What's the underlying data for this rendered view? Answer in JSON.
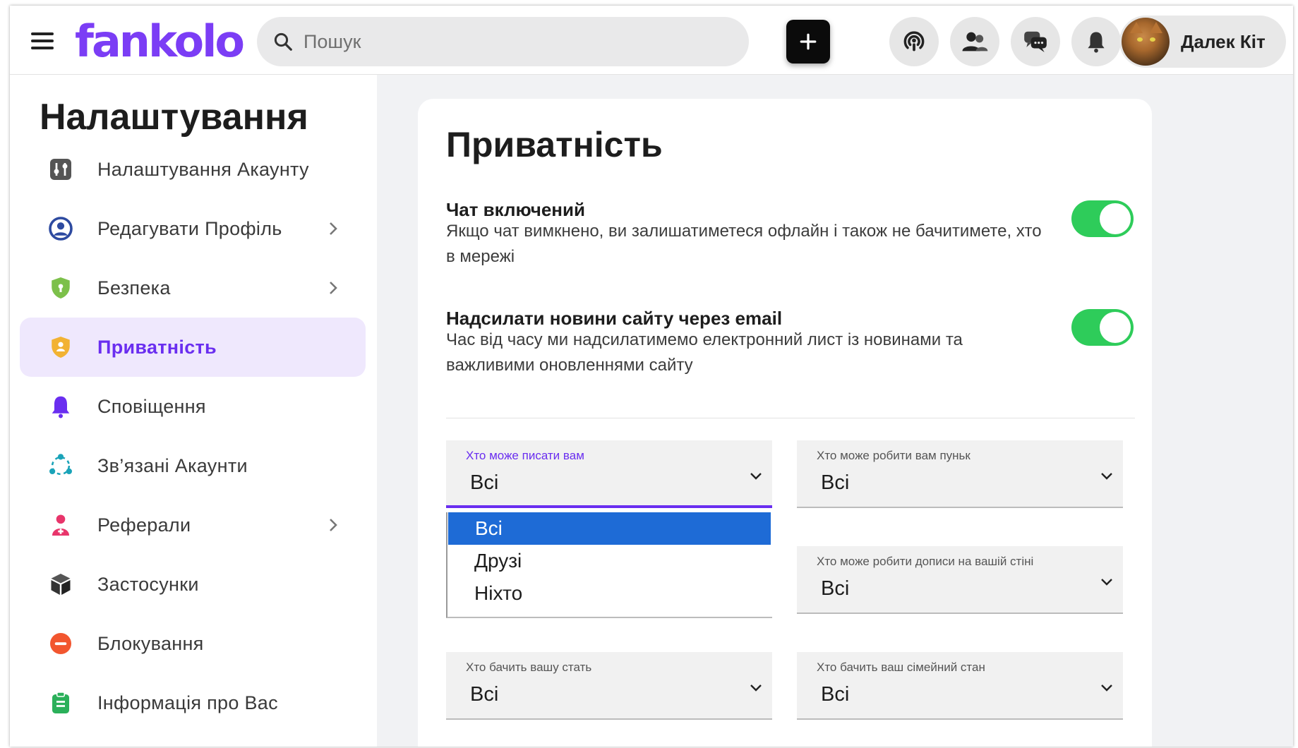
{
  "header": {
    "logo": "fankolo",
    "search_placeholder": "Пошук",
    "user_name": "Далек Кіт"
  },
  "sidebar": {
    "title": "Налаштування",
    "items": [
      {
        "label": "Налаштування Акаунту",
        "icon": "sliders-icon",
        "color": "#555555",
        "chevron": false
      },
      {
        "label": "Редагувати Профіль",
        "icon": "user-circle-icon",
        "color": "#2d4aa0",
        "chevron": true
      },
      {
        "label": "Безпека",
        "icon": "shield-icon",
        "color": "#7cc04a",
        "chevron": true
      },
      {
        "label": "Приватність",
        "icon": "privacy-shield-icon",
        "color": "#f2b233",
        "chevron": false,
        "active": true
      },
      {
        "label": "Сповіщення",
        "icon": "bell-icon",
        "color": "#6a2ef0",
        "chevron": false
      },
      {
        "label": "Зв’язані Акаунти",
        "icon": "share-nodes-icon",
        "color": "#1aa3b8",
        "chevron": false
      },
      {
        "label": "Реферали",
        "icon": "user-plus-icon",
        "color": "#e8356b",
        "chevron": true
      },
      {
        "label": "Застосунки",
        "icon": "cube-icon",
        "color": "#3a3a3a",
        "chevron": false
      },
      {
        "label": "Блокування",
        "icon": "minus-circle-icon",
        "color": "#f2562f",
        "chevron": false
      },
      {
        "label": "Інформація про Вас",
        "icon": "clipboard-icon",
        "color": "#2bb05a",
        "chevron": false
      }
    ]
  },
  "main": {
    "title": "Приватність",
    "settings": [
      {
        "title": "Чат включений",
        "desc": "Якщо чат вимкнено, ви залишатиметеся офлайн і також не бачитимете, хто в мережі",
        "enabled": true
      },
      {
        "title": "Надсилати новини сайту через email",
        "desc": "Час від часу ми надсилатимемо електронний лист із новинами та важливими оновленнями сайту",
        "enabled": true
      }
    ],
    "selects": [
      {
        "label": "Хто може писати вам",
        "value": "Всі"
      },
      {
        "label": "Хто може робити вам пуньк",
        "value": "Всі"
      },
      {
        "label": "Хто може робити дописи на вашій стіні",
        "value": "Всі"
      },
      {
        "label": "Хто бачить вашу стать",
        "value": "Всі"
      },
      {
        "label": "Хто бачить ваш сімейний стан",
        "value": "Всі"
      }
    ],
    "dropdown_options": [
      "Всі",
      "Друзі",
      "Ніхто"
    ],
    "dropdown_selected": "Всі"
  },
  "colors": {
    "accent": "#6a2ef0",
    "toggle_on": "#2ecc5a",
    "dropdown_highlight": "#1e6bd6"
  }
}
